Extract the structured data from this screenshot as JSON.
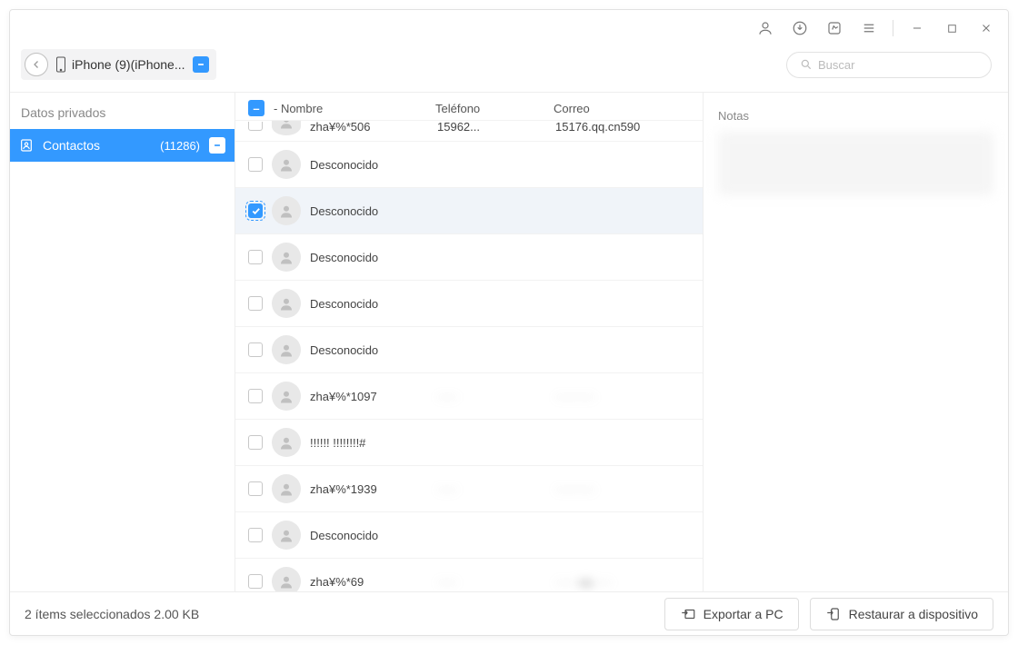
{
  "titlebar": {
    "icons": [
      "user-icon",
      "download-icon",
      "feedback-icon",
      "menu-icon"
    ]
  },
  "location": {
    "device": "iPhone (9)(iPhone...",
    "search_placeholder": "Buscar"
  },
  "sidebar": {
    "header": "Datos privados",
    "items": [
      {
        "label": "Contactos",
        "count": "(11286)"
      }
    ]
  },
  "columns": {
    "name": "- Nombre",
    "phone": "Teléfono",
    "mail": "Correo"
  },
  "contacts": [
    {
      "checked": false,
      "name": "zha¥%*506",
      "phone": "15962...",
      "mail": "15176.qq.cn590",
      "selected": false,
      "cut": true
    },
    {
      "checked": false,
      "name": "Desconocido",
      "phone": "",
      "mail": "",
      "selected": false
    },
    {
      "checked": true,
      "name": "Desconocido",
      "phone": "",
      "mail": "",
      "selected": true
    },
    {
      "checked": false,
      "name": "Desconocido",
      "phone": "",
      "mail": "",
      "selected": false
    },
    {
      "checked": false,
      "name": "Desconocido",
      "phone": "",
      "mail": "",
      "selected": false
    },
    {
      "checked": false,
      "name": "Desconocido",
      "phone": "",
      "mail": "",
      "selected": false
    },
    {
      "checked": false,
      "name": "zha¥%*1097",
      "phone": "·····",
      "mail": "··········",
      "selected": false,
      "blur": true
    },
    {
      "checked": false,
      "name": "!!!!!! !!!!!!!!#",
      "phone": "",
      "mail": "",
      "selected": false
    },
    {
      "checked": false,
      "name": "zha¥%*1939",
      "phone": "·····",
      "mail": "··········",
      "selected": false,
      "blur": true
    },
    {
      "checked": false,
      "name": "Desconocido",
      "phone": "",
      "mail": "",
      "selected": false
    },
    {
      "checked": false,
      "name": "zha¥%*69",
      "phone": "·····",
      "mail": "······qq·····",
      "selected": false,
      "blur": true
    }
  ],
  "detail": {
    "notes_label": "Notas"
  },
  "footer": {
    "status": "2 ítems seleccionados 2.00 KB",
    "export": "Exportar a PC",
    "restore": "Restaurar a dispositivo"
  }
}
